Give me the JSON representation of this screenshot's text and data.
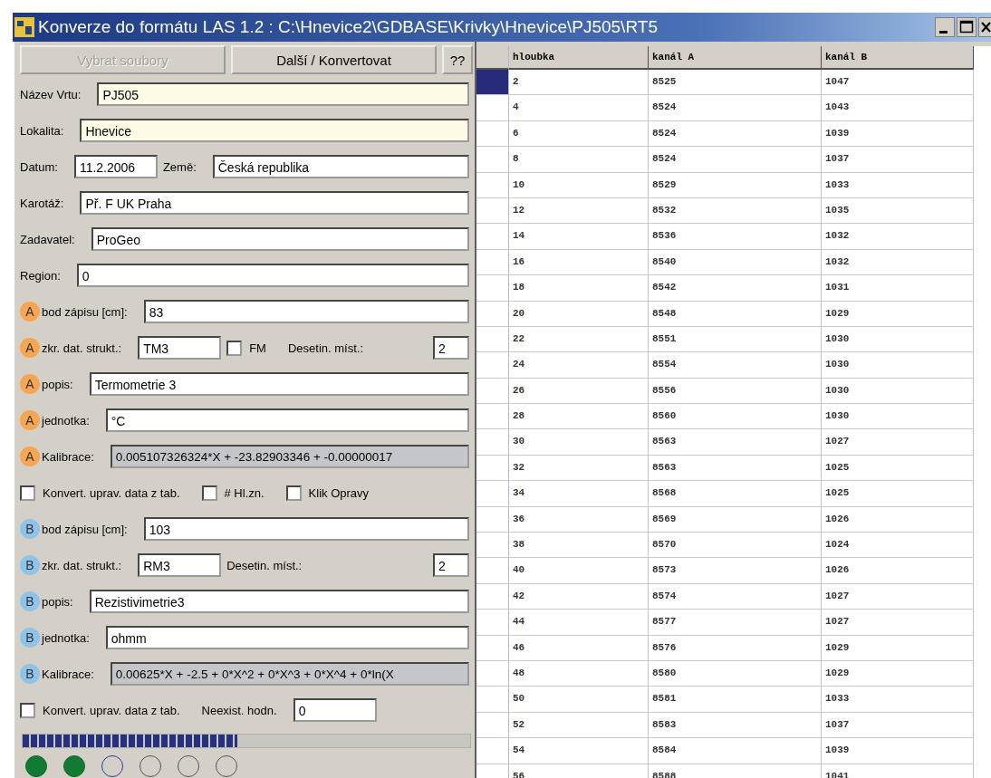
{
  "window": {
    "title": "Konverze do formátu LAS 1.2 : C:\\Hnevice2\\GDBASE\\Krivky\\Hnevice\\PJ505\\RT5"
  },
  "buttons": [
    {
      "label": "Vybrat soubory",
      "disabled": true
    },
    {
      "label": "Další / Konvertovat",
      "disabled": false
    },
    {
      "label": "??",
      "disabled": false
    }
  ],
  "form_rows": [
    {
      "items": [
        {
          "kind": "label",
          "text": "Název Vrtu:"
        },
        {
          "kind": "field",
          "value": "PJ505",
          "required": true
        }
      ]
    },
    {
      "items": [
        {
          "kind": "label",
          "text": "Lokalita:"
        },
        {
          "kind": "field",
          "value": "Hnevice",
          "required": true
        }
      ]
    },
    {
      "items": [
        {
          "kind": "label",
          "text": "Datum:"
        },
        {
          "kind": "short",
          "value": "11.2.2006"
        },
        {
          "kind": "label",
          "text": "Země:"
        },
        {
          "kind": "field",
          "value": "Česká republika"
        }
      ]
    },
    {
      "items": [
        {
          "kind": "label",
          "text": "Karotáž:"
        },
        {
          "kind": "field",
          "value": "Př. F UK Praha"
        }
      ]
    },
    {
      "items": [
        {
          "kind": "label",
          "text": "Zadavatel:"
        },
        {
          "kind": "field",
          "value": "ProGeo"
        }
      ]
    },
    {
      "items": [
        {
          "kind": "label",
          "text": "Region:"
        },
        {
          "kind": "field",
          "value": "0"
        }
      ]
    },
    {
      "items": [
        {
          "kind": "badge",
          "text": "A",
          "color": "#f6a552"
        },
        {
          "kind": "label",
          "text": "bod zápisu [cm]:"
        },
        {
          "kind": "field",
          "value": "83"
        }
      ]
    },
    {
      "items": [
        {
          "kind": "badge",
          "text": "A",
          "color": "#f6a552"
        },
        {
          "kind": "label",
          "text": "zkr. dat. strukt.:"
        },
        {
          "kind": "short",
          "value": "TM3"
        },
        {
          "kind": "checkbox",
          "text": "FM",
          "checked": false
        },
        {
          "kind": "label",
          "text": "Desetin. míst.:"
        },
        {
          "kind": "tiny",
          "value": "2"
        }
      ]
    },
    {
      "items": [
        {
          "kind": "badge",
          "text": "A",
          "color": "#f6a552"
        },
        {
          "kind": "label",
          "text": "popis:"
        },
        {
          "kind": "field",
          "value": "Termometrie 3"
        }
      ]
    },
    {
      "items": [
        {
          "kind": "badge",
          "text": "A",
          "color": "#f6a552"
        },
        {
          "kind": "label",
          "text": "jednotka:"
        },
        {
          "kind": "field",
          "value": "°C"
        }
      ]
    },
    {
      "items": [
        {
          "kind": "badge",
          "text": "A",
          "color": "#f6a552"
        },
        {
          "kind": "label",
          "text": "Kalibrace:"
        },
        {
          "kind": "field",
          "value": "0.005107326324*X + -23.82903346 + -0.00000017",
          "readonly": true
        }
      ]
    },
    {
      "items": [
        {
          "kind": "checkbox",
          "text": "Konvert. uprav. data z tab.",
          "checked": false
        },
        {
          "kind": "checkbox",
          "text": "# Hl.zn.",
          "checked": false
        },
        {
          "kind": "checkbox",
          "text": "Klik Opravy",
          "checked": false
        }
      ]
    },
    {
      "items": [
        {
          "kind": "badge",
          "text": "B",
          "color": "#8ec3ea"
        },
        {
          "kind": "label",
          "text": "bod zápisu [cm]:"
        },
        {
          "kind": "field",
          "value": "103"
        }
      ]
    },
    {
      "items": [
        {
          "kind": "badge",
          "text": "B",
          "color": "#8ec3ea"
        },
        {
          "kind": "label",
          "text": "zkr. dat. strukt.:"
        },
        {
          "kind": "short",
          "value": "RM3"
        },
        {
          "kind": "label",
          "text": "Desetin. míst.:"
        },
        {
          "kind": "tiny",
          "value": "2"
        }
      ]
    },
    {
      "items": [
        {
          "kind": "badge",
          "text": "B",
          "color": "#8ec3ea"
        },
        {
          "kind": "label",
          "text": "popis:"
        },
        {
          "kind": "field",
          "value": "Rezistivimetrie3"
        }
      ]
    },
    {
      "items": [
        {
          "kind": "badge",
          "text": "B",
          "color": "#8ec3ea"
        },
        {
          "kind": "label",
          "text": "jednotka:"
        },
        {
          "kind": "field",
          "value": "ohmm"
        }
      ]
    },
    {
      "items": [
        {
          "kind": "badge",
          "text": "B",
          "color": "#8ec3ea"
        },
        {
          "kind": "label",
          "text": "Kalibrace:"
        },
        {
          "kind": "field",
          "value": "0.00625*X + -2.5 + 0*X^2 + 0*X^3 + 0*X^4 + 0*ln(X",
          "readonly": true
        }
      ]
    },
    {
      "items": [
        {
          "kind": "checkbox",
          "text": "Konvert. uprav. data z tab.",
          "checked": false
        },
        {
          "kind": "label",
          "text": "Neexist. hodn."
        },
        {
          "kind": "short",
          "value": "0"
        }
      ]
    }
  ],
  "progress": {
    "level": 0.48
  },
  "steps": [
    {
      "done": true,
      "selected": false
    },
    {
      "done": true,
      "selected": false
    },
    {
      "done": false,
      "selected": true
    },
    {
      "done": false,
      "selected": false
    },
    {
      "done": false,
      "selected": false
    },
    {
      "done": false,
      "selected": false
    }
  ],
  "table": {
    "columns": [
      "hloubka",
      "kanál A",
      "kanál B"
    ],
    "rows": [
      {
        "cells": [
          "2",
          "8525",
          "1047"
        ],
        "selected": true
      },
      {
        "cells": [
          "4",
          "8524",
          "1043"
        ],
        "selected": false
      },
      {
        "cells": [
          "6",
          "8524",
          "1039"
        ],
        "selected": false
      },
      {
        "cells": [
          "8",
          "8524",
          "1037"
        ],
        "selected": false
      },
      {
        "cells": [
          "10",
          "8529",
          "1033"
        ],
        "selected": false
      },
      {
        "cells": [
          "12",
          "8532",
          "1035"
        ],
        "selected": false
      },
      {
        "cells": [
          "14",
          "8536",
          "1032"
        ],
        "selected": false
      },
      {
        "cells": [
          "16",
          "8540",
          "1032"
        ],
        "selected": false
      },
      {
        "cells": [
          "18",
          "8542",
          "1031"
        ],
        "selected": false
      },
      {
        "cells": [
          "20",
          "8548",
          "1029"
        ],
        "selected": false
      },
      {
        "cells": [
          "22",
          "8551",
          "1030"
        ],
        "selected": false
      },
      {
        "cells": [
          "24",
          "8554",
          "1030"
        ],
        "selected": false
      },
      {
        "cells": [
          "26",
          "8556",
          "1030"
        ],
        "selected": false
      },
      {
        "cells": [
          "28",
          "8560",
          "1030"
        ],
        "selected": false
      },
      {
        "cells": [
          "30",
          "8563",
          "1027"
        ],
        "selected": false
      },
      {
        "cells": [
          "32",
          "8563",
          "1025"
        ],
        "selected": false
      },
      {
        "cells": [
          "34",
          "8568",
          "1025"
        ],
        "selected": false
      },
      {
        "cells": [
          "36",
          "8569",
          "1026"
        ],
        "selected": false
      },
      {
        "cells": [
          "38",
          "8570",
          "1024"
        ],
        "selected": false
      },
      {
        "cells": [
          "40",
          "8573",
          "1026"
        ],
        "selected": false
      },
      {
        "cells": [
          "42",
          "8574",
          "1027"
        ],
        "selected": false
      },
      {
        "cells": [
          "44",
          "8577",
          "1027"
        ],
        "selected": false
      },
      {
        "cells": [
          "46",
          "8576",
          "1029"
        ],
        "selected": false
      },
      {
        "cells": [
          "48",
          "8580",
          "1029"
        ],
        "selected": false
      },
      {
        "cells": [
          "50",
          "8581",
          "1033"
        ],
        "selected": false
      },
      {
        "cells": [
          "52",
          "8583",
          "1037"
        ],
        "selected": false
      },
      {
        "cells": [
          "54",
          "8584",
          "1039"
        ],
        "selected": false
      },
      {
        "cells": [
          "56",
          "8588",
          "1041"
        ],
        "selected": false
      }
    ]
  }
}
